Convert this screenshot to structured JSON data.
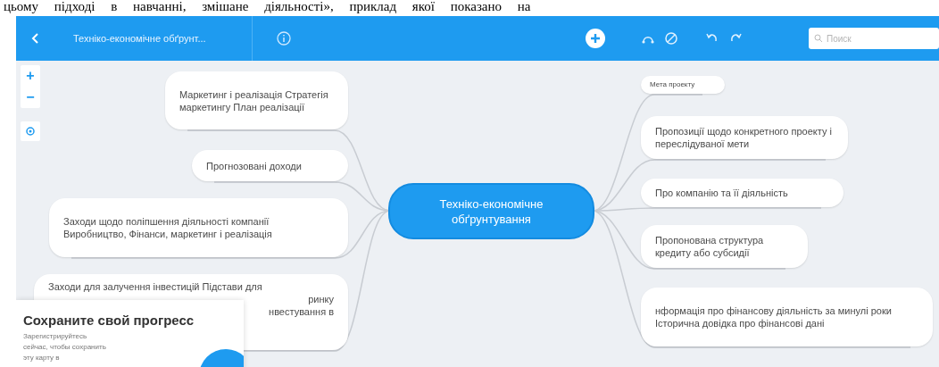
{
  "document_text": "цьому підході в навчанні, змішане діяльності», приклад якої показано на",
  "toolbar": {
    "title": "Техніко-економічне обґрунт...",
    "search": {
      "placeholder": "Поиск"
    }
  },
  "zoom_controls": [
    "+",
    "−"
  ],
  "central_topic": "Техніко-економічне обґрунтування",
  "left_topics": [
    {
      "kind": "plain",
      "text": "Маркетинг і реалізація Стратегія маркетингу План реалізації"
    },
    {
      "kind": "plain",
      "text": "Прогнозовані доходи"
    },
    {
      "kind": "plain",
      "text": "Заходи щодо поліпшення діяльності компанії Виробництво, Фінанси, маркетинг і реалізація"
    },
    {
      "kind": "covered",
      "lines": [
        "Заходи для залучення інвестицій Підстави для",
        "ринку",
        "нвестування в"
      ]
    }
  ],
  "right_topics": [
    {
      "kind": "small",
      "text": "Мета проекту"
    },
    {
      "kind": "plain",
      "text": "Пропозиції щодо конкретного проекту і переслідуваної мети"
    },
    {
      "kind": "plain",
      "text": "Про компанію та її діяльність"
    },
    {
      "kind": "plain",
      "text": "Пропонована структура кредиту або субсидії"
    },
    {
      "kind": "plain",
      "text": "нформація про фінансову діяльність за минулі роки Історична довідка про фінансові дані"
    }
  ],
  "popup": {
    "title": "Сохраните свой прогресс",
    "text": "Зарегистрируйтесь сейчас, чтобы сохранить эту карту в"
  }
}
